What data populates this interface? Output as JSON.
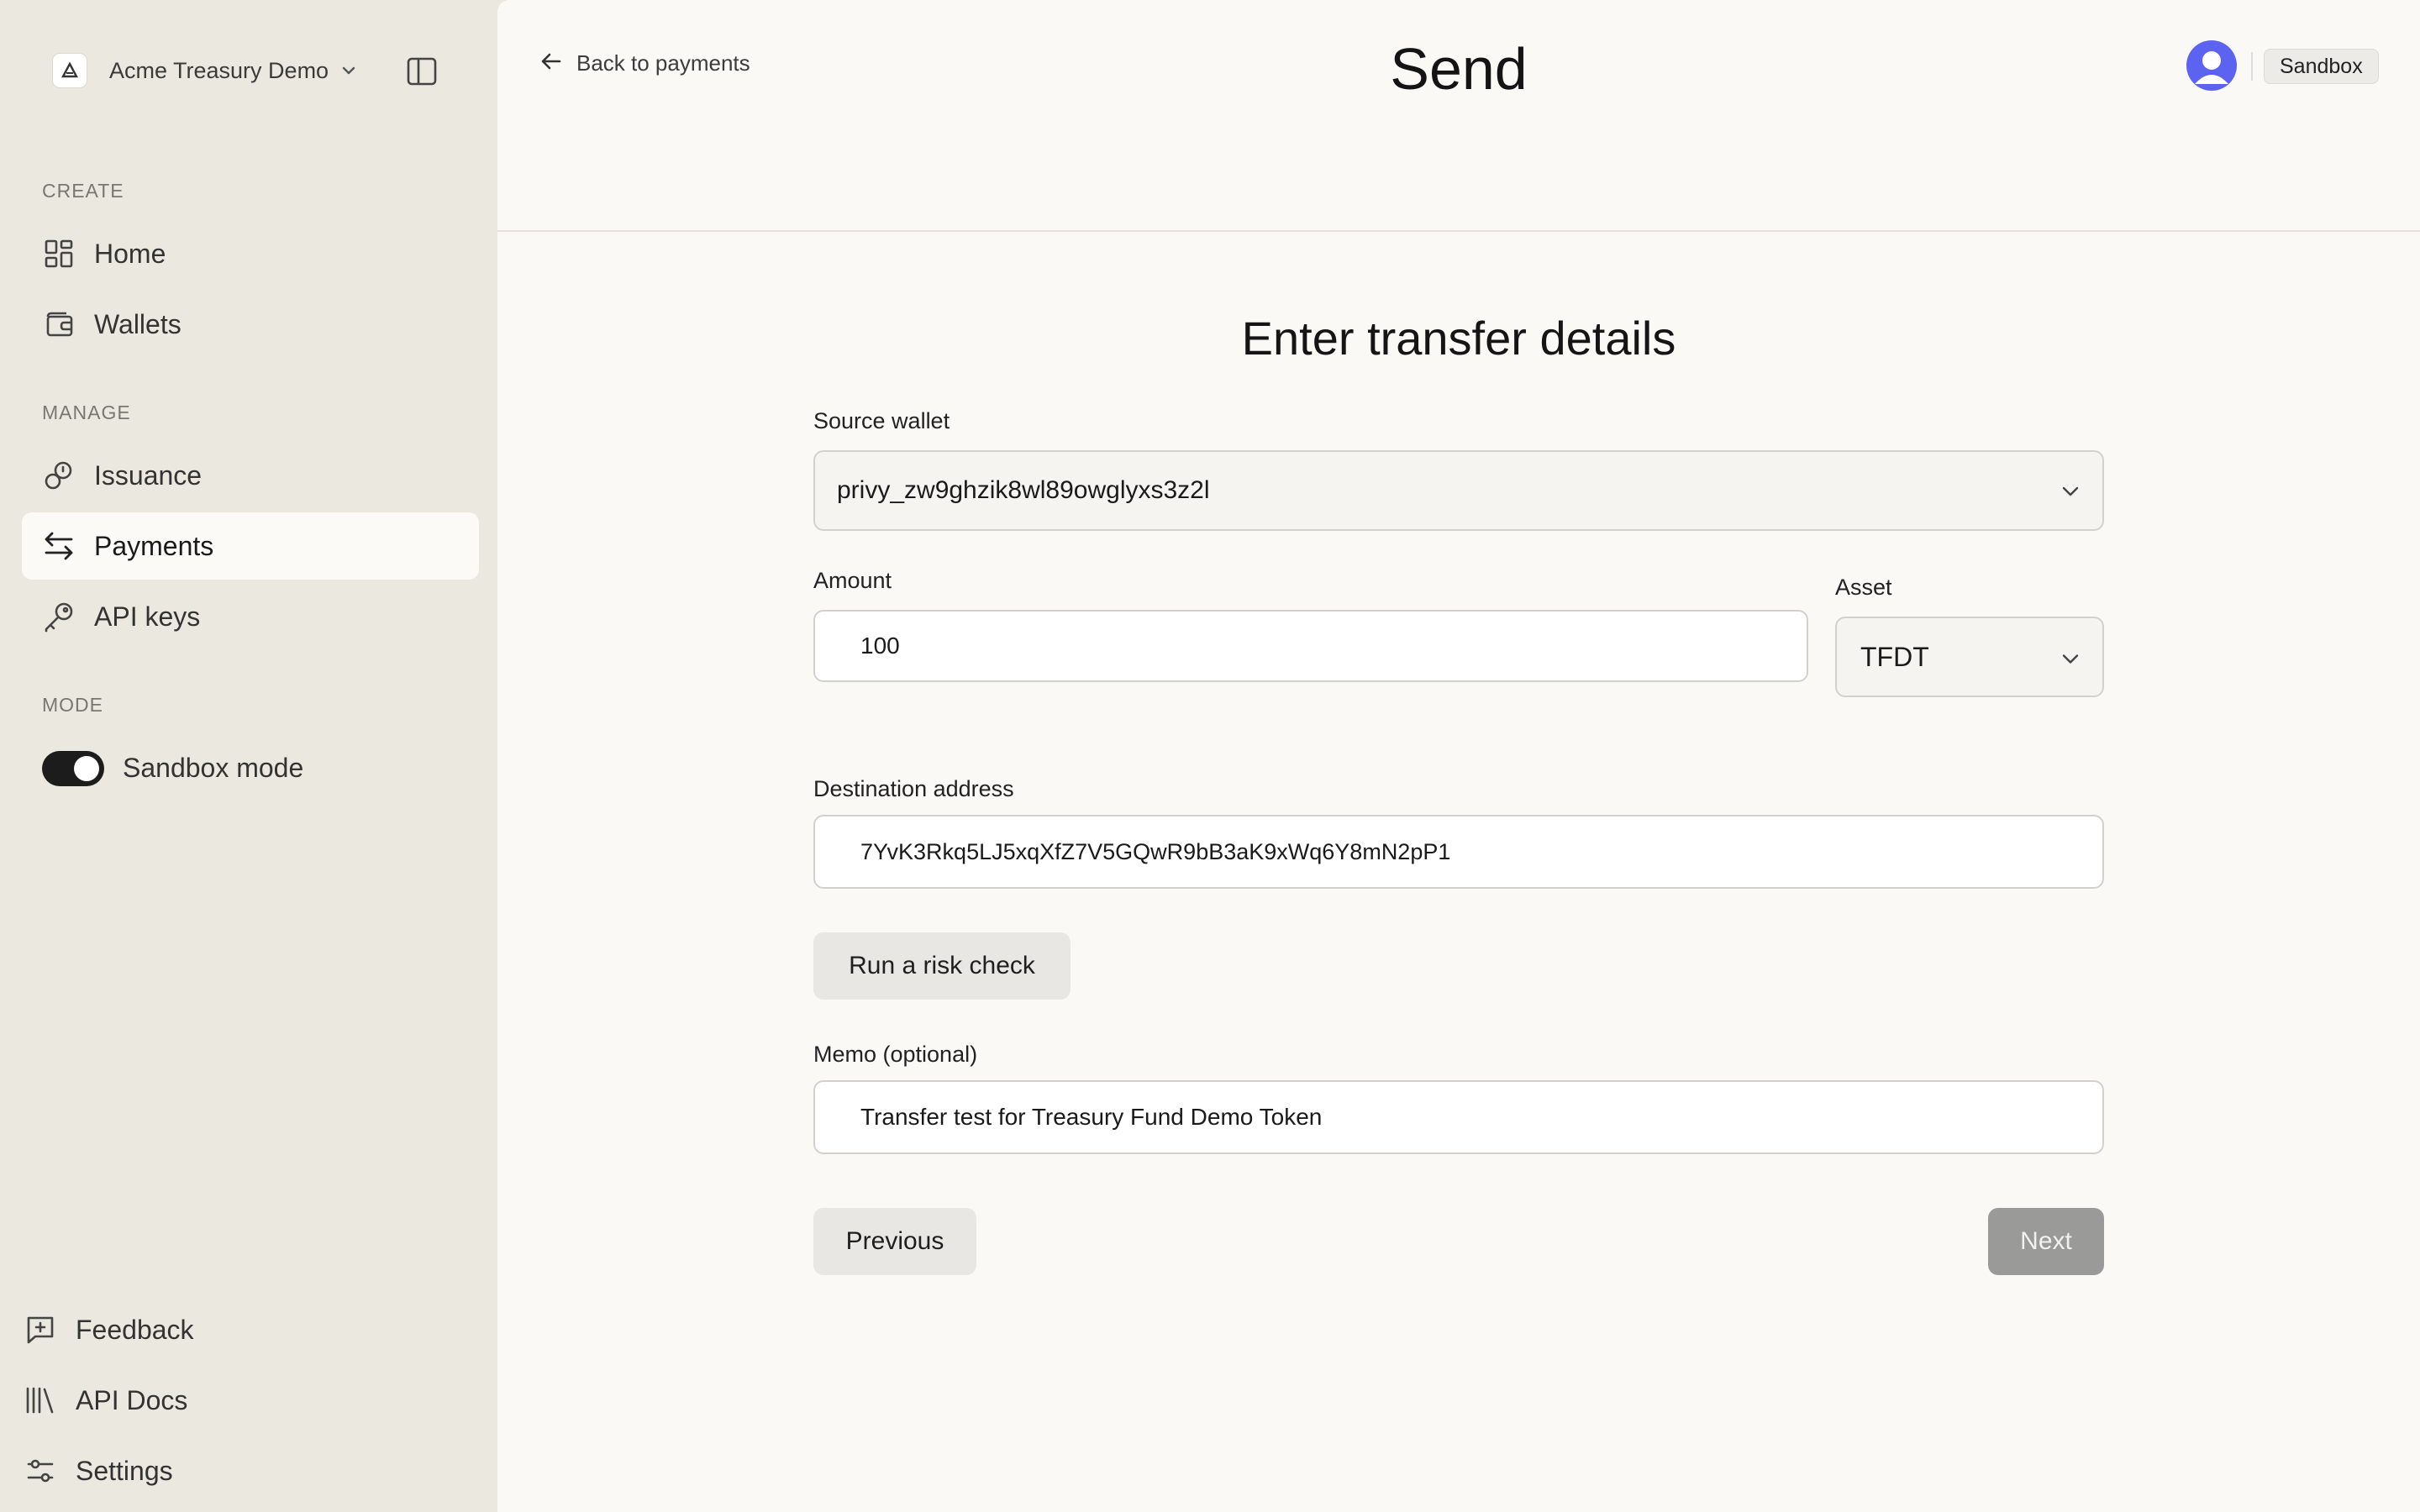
{
  "sidebar": {
    "org_name": "Acme Treasury Demo",
    "sections": {
      "create": "CREATE",
      "manage": "MANAGE",
      "mode": "MODE"
    },
    "items": [
      {
        "label": "Home",
        "icon": "grid-icon"
      },
      {
        "label": "Wallets",
        "icon": "wallet-icon"
      },
      {
        "label": "Issuance",
        "icon": "issuance-icon"
      },
      {
        "label": "Payments",
        "icon": "arrows-exchange-icon",
        "active": true
      },
      {
        "label": "API keys",
        "icon": "key-icon"
      }
    ],
    "mode_toggle": {
      "label": "Sandbox mode",
      "on": true
    },
    "footer": [
      {
        "label": "Feedback",
        "icon": "feedback-icon"
      },
      {
        "label": "API Docs",
        "icon": "library-icon"
      },
      {
        "label": "Settings",
        "icon": "sliders-icon"
      }
    ]
  },
  "header": {
    "back_label": "Back to payments",
    "title": "Send",
    "env_badge": "Sandbox"
  },
  "form": {
    "heading": "Enter transfer details",
    "source_wallet": {
      "label": "Source wallet",
      "value": "privy_zw9ghzik8wl89owglyxs3z2l"
    },
    "amount": {
      "label": "Amount",
      "value": "100"
    },
    "asset": {
      "label": "Asset",
      "value": "TFDT"
    },
    "destination": {
      "label": "Destination address",
      "value": "7YvK3Rkq5LJ5xqXfZ7V5GQwR9bB3aK9xWq6Y8mN2pP1"
    },
    "risk_check_label": "Run a risk check",
    "memo": {
      "label": "Memo (optional)",
      "value": "Transfer test for Treasury Fund Demo Token"
    },
    "previous_label": "Previous",
    "next_label": "Next",
    "next_enabled": false
  },
  "colors": {
    "sidebar_bg": "#ebe8e0",
    "main_bg": "#faf9f6",
    "avatar": "#5b63f0",
    "next_disabled": "#9a9a98"
  }
}
